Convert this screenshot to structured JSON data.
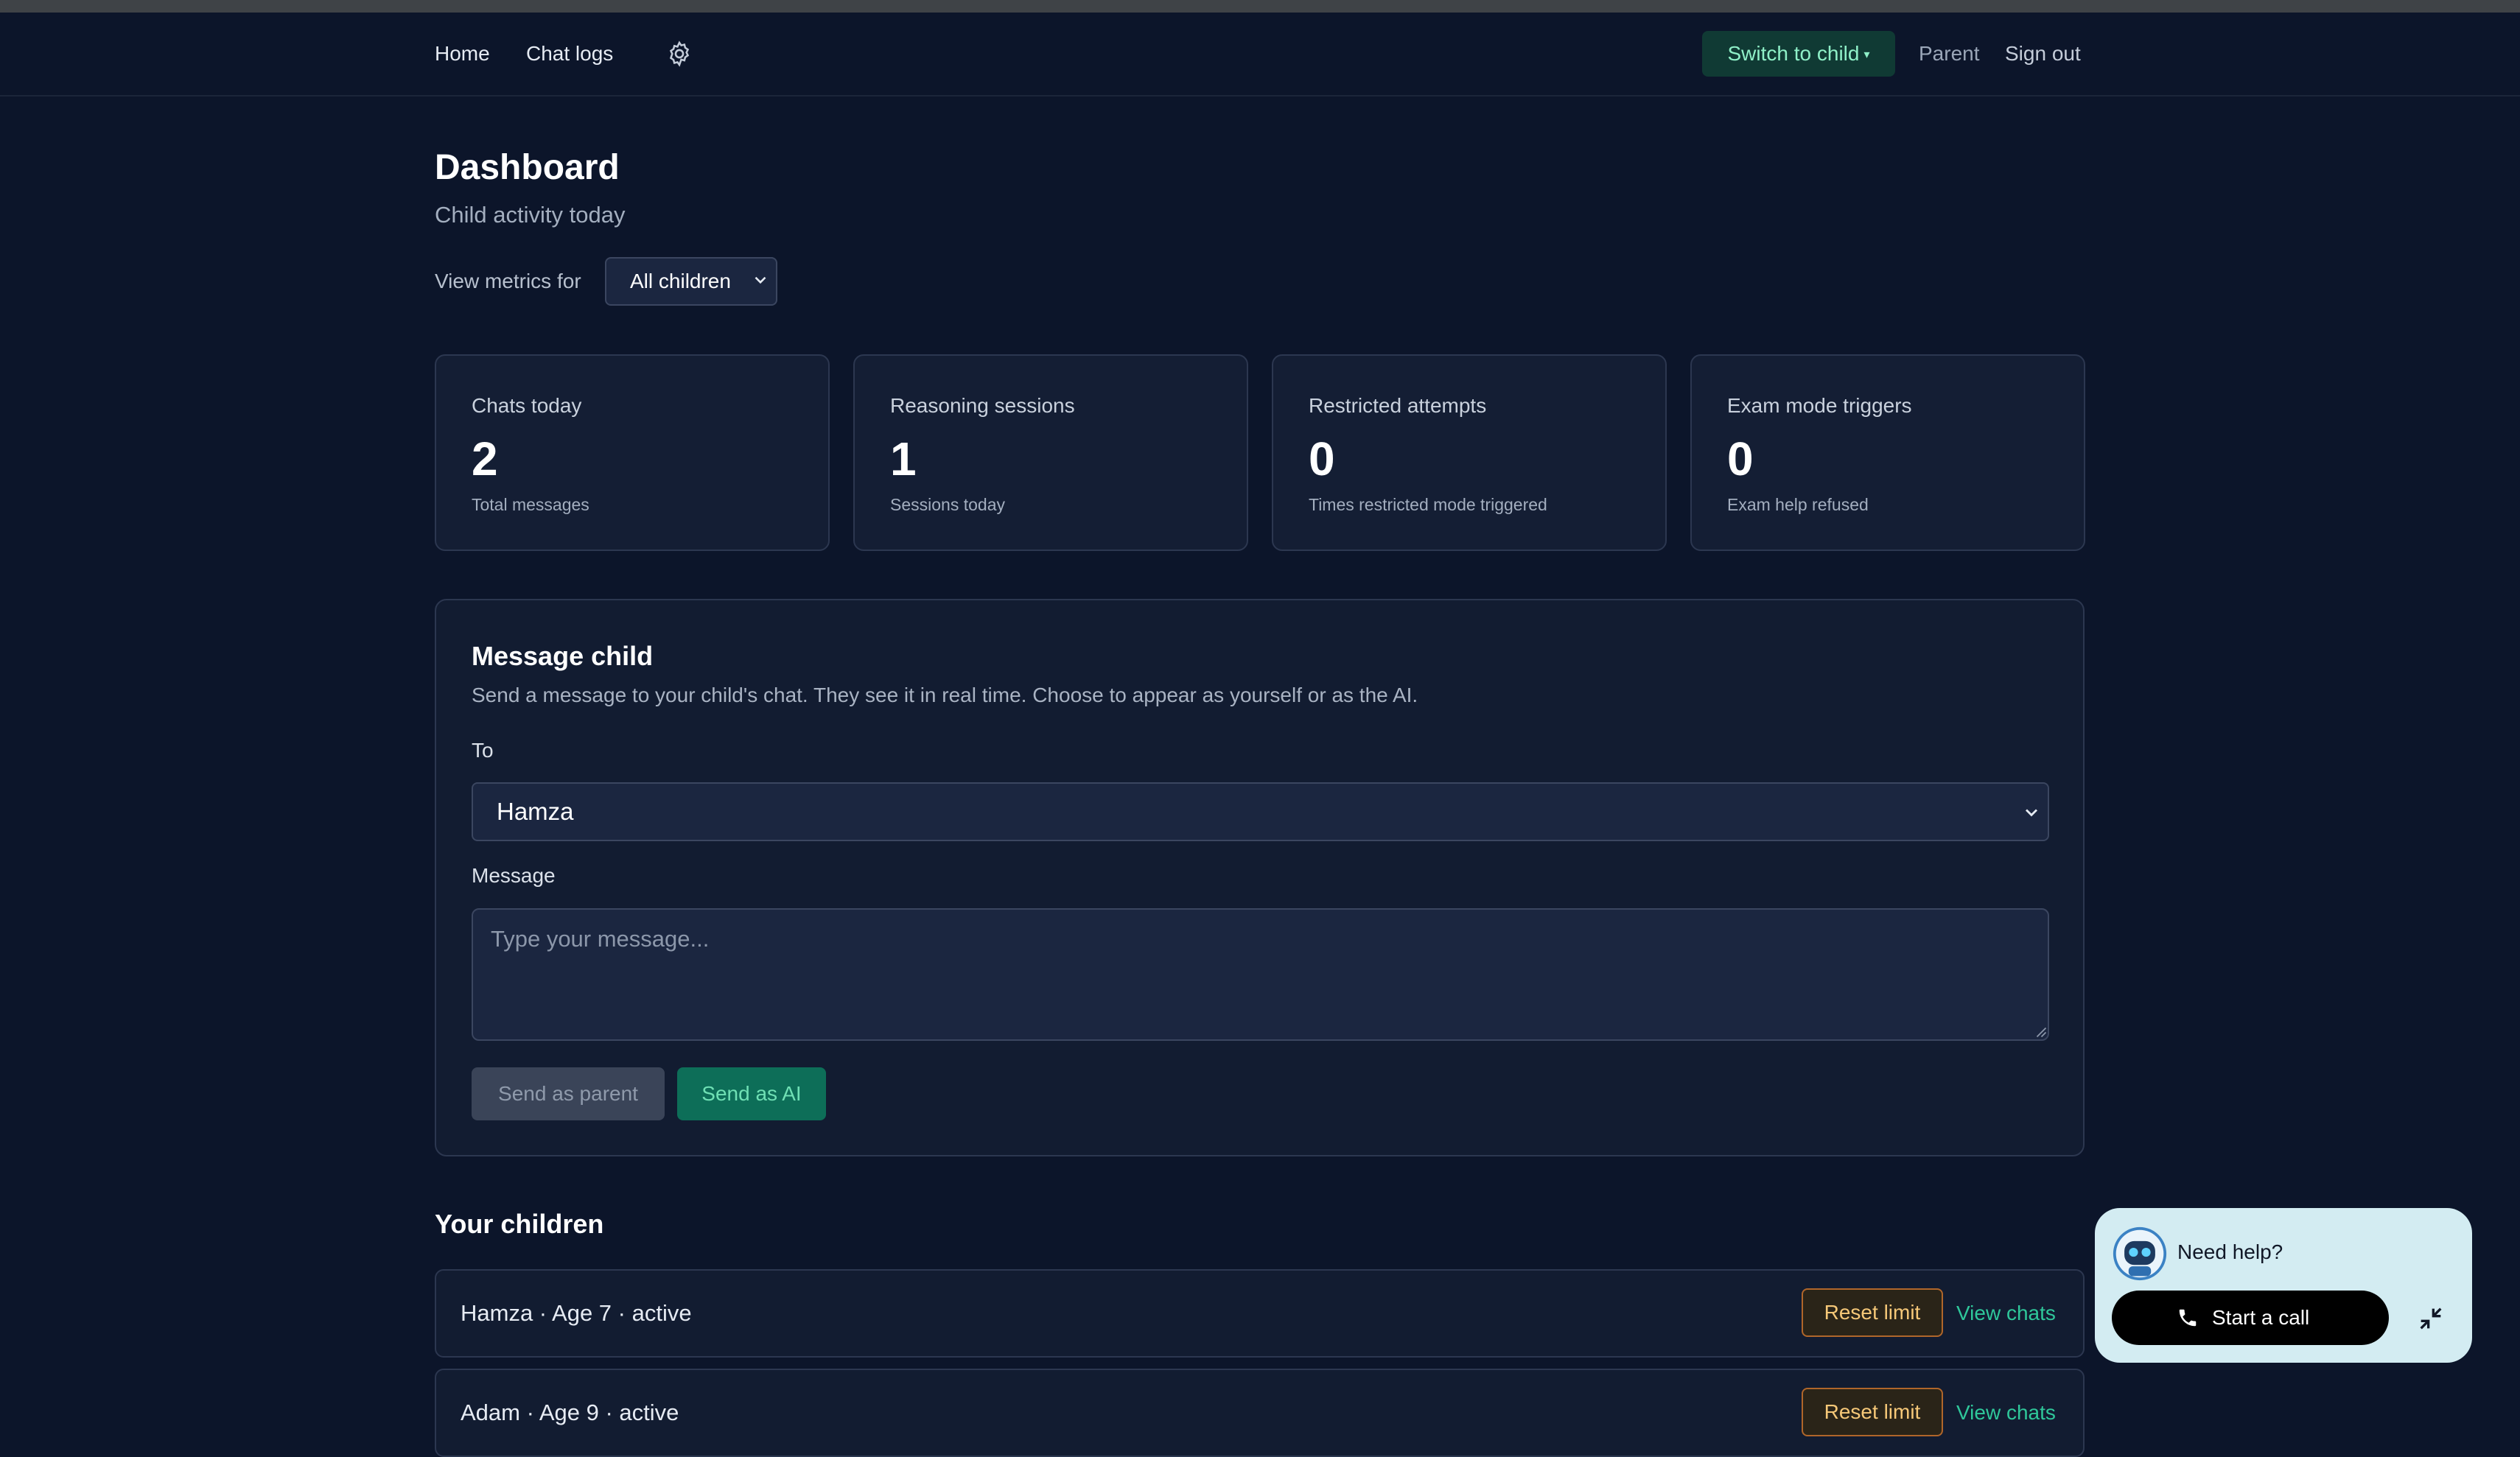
{
  "nav": {
    "home": "Home",
    "chat_logs": "Chat logs",
    "switch_label": "Switch to child",
    "switch_caret": "▾",
    "role": "Parent",
    "sign_out": "Sign out"
  },
  "header": {
    "title": "Dashboard",
    "subtitle": "Child activity today",
    "metrics_label": "View metrics for",
    "metrics_selected": "All children"
  },
  "stats": [
    {
      "label": "Chats today",
      "value": "2",
      "note": "Total messages"
    },
    {
      "label": "Reasoning sessions",
      "value": "1",
      "note": "Sessions today"
    },
    {
      "label": "Restricted attempts",
      "value": "0",
      "note": "Times restricted mode triggered"
    },
    {
      "label": "Exam mode triggers",
      "value": "0",
      "note": "Exam help refused"
    }
  ],
  "message_panel": {
    "title": "Message child",
    "description": "Send a message to your child's chat. They see it in real time. Choose to appear as yourself or as the AI.",
    "to_label": "To",
    "to_selected": "Hamza",
    "message_label": "Message",
    "message_value": "",
    "message_placeholder": "Type your message...",
    "send_parent": "Send as parent",
    "send_ai": "Send as AI"
  },
  "children": {
    "title": "Your children",
    "rows": [
      {
        "info": "Hamza · Age 7 · active",
        "reset": "Reset limit",
        "view": "View chats"
      },
      {
        "info": "Adam · Age 9 · active",
        "reset": "Reset limit",
        "view": "View chats"
      }
    ]
  },
  "help_widget": {
    "prompt": "Need help?",
    "call_label": "Start a call"
  },
  "colors": {
    "background": "#0c152a",
    "card": "#141e34",
    "accent_green": "#0d6e58",
    "link_green": "#2fc79a",
    "warning_orange": "#b0662a",
    "widget_bg": "#d3ecf2"
  },
  "icons": {
    "settings": "gear-icon",
    "dropdown": "chevron-down-icon",
    "avatar": "robot-avatar-icon",
    "call": "phone-icon",
    "collapse": "collapse-icon"
  }
}
